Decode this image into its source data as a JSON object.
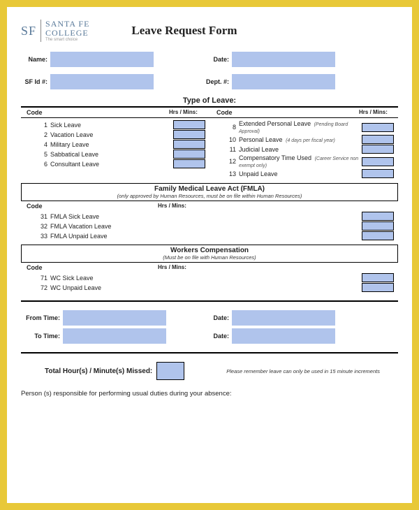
{
  "logo": {
    "sf": "SF",
    "line1": "SANTA FE",
    "line2": "COLLEGE",
    "tagline": "The smart choice"
  },
  "title": "Leave Request Form",
  "fields": {
    "name": "Name:",
    "date": "Date:",
    "sfid": "SF Id #:",
    "dept": "Dept. #:"
  },
  "type_of_leave": "Type of Leave:",
  "headers": {
    "code": "Code",
    "hrs": "Hrs / Mins:"
  },
  "leaves_left": [
    {
      "n": "1",
      "nm": "Sick Leave"
    },
    {
      "n": "2",
      "nm": "Vacation Leave"
    },
    {
      "n": "4",
      "nm": "Military Leave"
    },
    {
      "n": "5",
      "nm": "Sabbatical Leave"
    },
    {
      "n": "6",
      "nm": "Consultant Leave"
    }
  ],
  "leaves_right": [
    {
      "n": "8",
      "nm": "Extended Personal Leave",
      "note": "(Pending Board Approval)"
    },
    {
      "n": "10",
      "nm": "Personal Leave",
      "note": "(4 days per fiscal year)"
    },
    {
      "n": "11",
      "nm": "Judicial Leave",
      "note": ""
    },
    {
      "n": "12",
      "nm": "Compensatory Time Used",
      "note": "(Career Service non exempt only)"
    },
    {
      "n": "13",
      "nm": "Unpaid Leave",
      "note": ""
    }
  ],
  "fmla": {
    "title": "Family Medical Leave Act (FMLA)",
    "note": "(only approved by Human Resources, must be on file within Human Resources)"
  },
  "fmla_items": [
    {
      "n": "31",
      "nm": "FMLA Sick Leave"
    },
    {
      "n": "32",
      "nm": "FMLA Vacation Leave"
    },
    {
      "n": "33",
      "nm": "FMLA Unpaid Leave"
    }
  ],
  "wc": {
    "title": "Workers Compensation",
    "note": "(Must be on file with Human Resources)"
  },
  "wc_items": [
    {
      "n": "71",
      "nm": "WC Sick Leave"
    },
    {
      "n": "72",
      "nm": "WC Unpaid Leave"
    }
  ],
  "time": {
    "from": "From Time:",
    "to": "To Time:",
    "date": "Date:"
  },
  "total": {
    "label": "Total Hour(s) / Minute(s) Missed:",
    "note": "Please remember leave can only be used in 15 minute increments"
  },
  "person": "Person (s) responsible for performing usual duties during your absence:"
}
